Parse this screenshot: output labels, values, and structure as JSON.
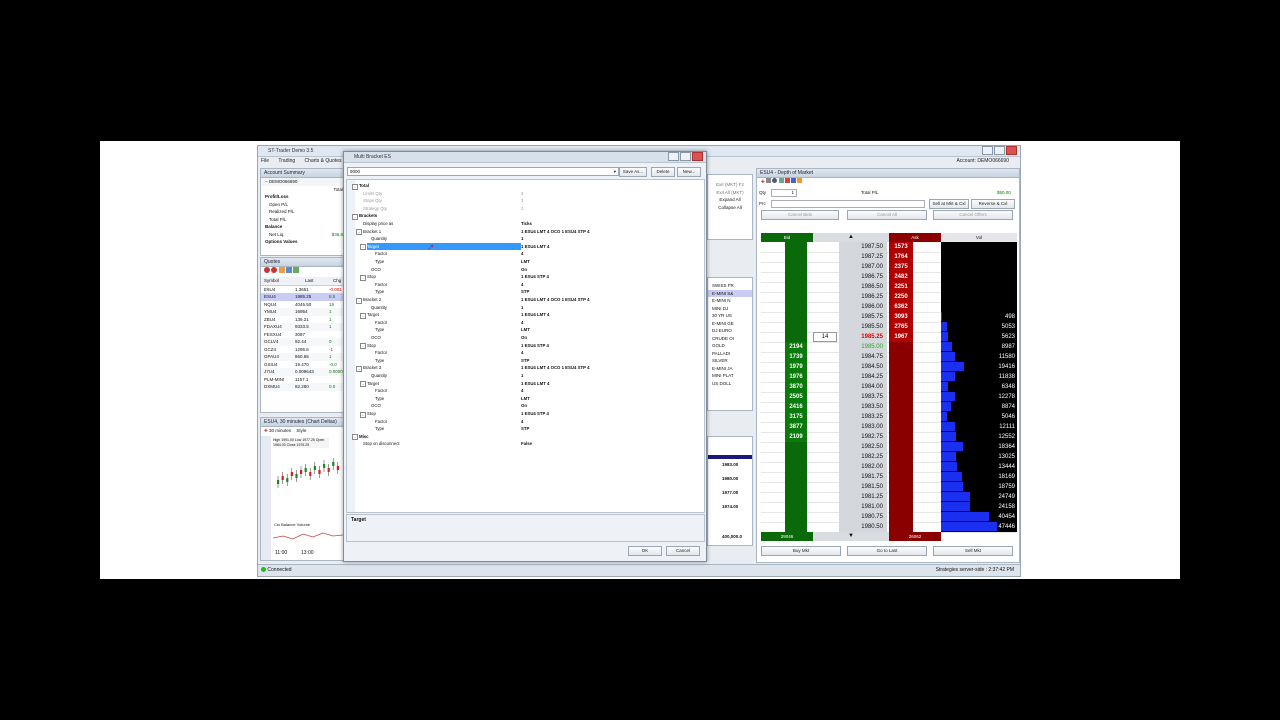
{
  "app": {
    "title": "ST-Trader Demo 3.5",
    "menu": [
      "File",
      "Trading",
      "Charts & Quotes"
    ],
    "account_label": "Account: DEMO066690",
    "status": "Connected",
    "strategies_status": "Strategies server-side : 2:37:42 PM"
  },
  "account_summary": {
    "header": "Account Summary",
    "account": "DEMO066690",
    "total_label": "Total",
    "rows": [
      "Profit/Loss",
      "Open P/L",
      "Realized P/L",
      "Total P/L",
      "Balance",
      "Net Liq.",
      "Options Values"
    ],
    "netliq_value": "$36,8"
  },
  "quotes": {
    "header": "Quotes",
    "columns": [
      "Symbol",
      "Last",
      "Chg"
    ],
    "rows": [
      {
        "symbol": "E6U4",
        "last": "1.3651",
        "chg": "-0.001"
      },
      {
        "symbol": "ESU4",
        "last": "1985.25",
        "chg": "8.5"
      },
      {
        "symbol": "NQU4",
        "last": "4045.50",
        "chg": "19"
      },
      {
        "symbol": "YMU4",
        "last": "16954",
        "chg": "1"
      },
      {
        "symbol": "ZBU4",
        "last": "139.21",
        "chg": "1"
      },
      {
        "symbol": "FDAXU4",
        "last": "9333.5",
        "chg": "1"
      },
      {
        "symbol": "FESXU4",
        "last": "3087",
        "chg": ""
      },
      {
        "symbol": "GCLV4",
        "last": "92.44",
        "chg": "0"
      },
      {
        "symbol": "GCZ4",
        "last": "1295.6",
        "chg": "-1"
      },
      {
        "symbol": "GPAU4",
        "last": "860.65",
        "chg": "1"
      },
      {
        "symbol": "GSIU4",
        "last": "19.470",
        "chg": "-0.0"
      },
      {
        "symbol": "J7U4",
        "last": "0.009643",
        "chg": "0.00000"
      },
      {
        "symbol": "PLM-MINI",
        "last": "1157.1",
        "chg": ""
      },
      {
        "symbol": "DXMU4",
        "last": "82.280",
        "chg": "0.0"
      }
    ]
  },
  "chart": {
    "header": "ESU4, 30 minutes (Chart Deltas)",
    "interval": "30 minutes",
    "style_label": "Style",
    "legend": "High 1991.00  Low 1977.25  Open 1984.00  Close 1976.25",
    "indicator": "Ctx Balance Volume",
    "times": [
      "11:00",
      "13:00"
    ]
  },
  "mid_panel": {
    "items": [
      "Exit (MKT) F2",
      "Exit All (MKT)",
      "Expand All",
      "Collapse All"
    ],
    "desc_rows": [
      "SWISS FR",
      "E-MINI S&",
      "E-MINI N",
      "MINI DJ",
      "30 YR US",
      "E-MINI GE",
      "DJ EURO",
      "CRUDE OI",
      "GOLD",
      "PALLADI",
      "SILVER",
      "E-MINI JA",
      "MINI PLAT",
      "US DOLL"
    ],
    "prices": [
      "1983.00",
      "1980.00",
      "1977.00",
      "1974.00",
      "400,000.0"
    ]
  },
  "dialog": {
    "title": "Multi Bracket ES",
    "preset": "9000",
    "save_as": "Save As...",
    "delete": "Delete",
    "new": "New...",
    "rows": [
      {
        "name": "Total",
        "val": "",
        "indent": 1,
        "cat": true,
        "exp": "-"
      },
      {
        "name": "Limits Qty",
        "val": "3",
        "indent": 2,
        "grey": true
      },
      {
        "name": "Stops Qty",
        "val": "3",
        "indent": 2,
        "grey": true
      },
      {
        "name": "Strategy Qty",
        "val": "3",
        "indent": 2,
        "grey": true
      },
      {
        "name": "Brackets",
        "val": "",
        "indent": 1,
        "cat": true,
        "exp": "-"
      },
      {
        "name": "Display price as",
        "val": "Ticks",
        "indent": 2
      },
      {
        "name": "Bracket 1",
        "val": "1 ESU4 LMT 4 OCO 1 ESU4 STP 4",
        "indent": 2,
        "exp": "-"
      },
      {
        "name": "Quantity",
        "val": "1",
        "indent": 4
      },
      {
        "name": "Target",
        "val": "1 ESU4 LMT 4",
        "indent": 3,
        "exp": "-",
        "selected": true
      },
      {
        "name": "Factor",
        "val": "4",
        "indent": 5
      },
      {
        "name": "Type",
        "val": "LMT",
        "indent": 5
      },
      {
        "name": "OCO",
        "val": "On",
        "indent": 4
      },
      {
        "name": "Stop",
        "val": "1 ESU4 STP 4",
        "indent": 3,
        "exp": "-"
      },
      {
        "name": "Factor",
        "val": "4",
        "indent": 5
      },
      {
        "name": "Type",
        "val": "STP",
        "indent": 5
      },
      {
        "name": "Bracket 2",
        "val": "1 ESU4 LMT 4 OCO 1 ESU4 STP 4",
        "indent": 2,
        "exp": "-"
      },
      {
        "name": "Quantity",
        "val": "1",
        "indent": 4
      },
      {
        "name": "Target",
        "val": "1 ESU4 LMT 4",
        "indent": 3,
        "exp": "-"
      },
      {
        "name": "Factor",
        "val": "4",
        "indent": 5
      },
      {
        "name": "Type",
        "val": "LMT",
        "indent": 5
      },
      {
        "name": "OCO",
        "val": "On",
        "indent": 4
      },
      {
        "name": "Stop",
        "val": "1 ESU4 STP 4",
        "indent": 3,
        "exp": "-"
      },
      {
        "name": "Factor",
        "val": "4",
        "indent": 5
      },
      {
        "name": "Type",
        "val": "STP",
        "indent": 5
      },
      {
        "name": "Bracket 3",
        "val": "1 ESU4 LMT 4 OCO 1 ESU4 STP 4",
        "indent": 2,
        "exp": "-"
      },
      {
        "name": "Quantity",
        "val": "1",
        "indent": 4
      },
      {
        "name": "Target",
        "val": "1 ESU4 LMT 4",
        "indent": 3,
        "exp": "-"
      },
      {
        "name": "Factor",
        "val": "4",
        "indent": 5
      },
      {
        "name": "Type",
        "val": "LMT",
        "indent": 5
      },
      {
        "name": "OCO",
        "val": "On",
        "indent": 4
      },
      {
        "name": "Stop",
        "val": "1 ESU4 STP 4",
        "indent": 3,
        "exp": "-"
      },
      {
        "name": "Factor",
        "val": "4",
        "indent": 5
      },
      {
        "name": "Type",
        "val": "STP",
        "indent": 5
      },
      {
        "name": "Misc",
        "val": "",
        "indent": 1,
        "cat": true,
        "exp": "-"
      },
      {
        "name": "Stop on disconnect",
        "val": "False",
        "indent": 2
      }
    ],
    "description_title": "Target",
    "ok": "OK",
    "cancel": "Cancel"
  },
  "dom": {
    "header": "ESU4 - Depth of Market",
    "qty_label": "Qty",
    "qty_value": "1",
    "total_pl_label": "Total P/L",
    "total_pl_value": "$50.00",
    "price_label": "Prc",
    "buttons_top": [
      "Sell at Mkt & Cxl",
      "Reverse & Cxl",
      "Cancel Bids",
      "Cancel All",
      "Cancel Offers"
    ],
    "col_bid": "Bid",
    "col_ask": "Ask",
    "col_vol": "Vol",
    "rows": [
      {
        "price": "1987.50",
        "ask": "1573",
        "vol": ""
      },
      {
        "price": "1987.25",
        "ask": "1764",
        "vol": ""
      },
      {
        "price": "1987.00",
        "ask": "2375",
        "vol": ""
      },
      {
        "price": "1986.75",
        "ask": "2482",
        "vol": ""
      },
      {
        "price": "1986.50",
        "ask": "2251",
        "vol": ""
      },
      {
        "price": "1986.25",
        "ask": "2250",
        "vol": ""
      },
      {
        "price": "1986.00",
        "ask": "6362",
        "vol": ""
      },
      {
        "price": "1985.75",
        "ask": "3093",
        "vol": "498"
      },
      {
        "price": "1985.50",
        "ask": "2765",
        "vol": "5053"
      },
      {
        "price": "1985.25",
        "ask": "1967",
        "vol": "5623",
        "last": true,
        "pos": "14"
      },
      {
        "price": "1985.00",
        "bid": "2194",
        "vol": "8987",
        "bidlast": true
      },
      {
        "price": "1984.75",
        "bid": "1739",
        "vol": "11580"
      },
      {
        "price": "1984.50",
        "bid": "1979",
        "vol": "19416"
      },
      {
        "price": "1984.25",
        "bid": "1976",
        "vol": "11838"
      },
      {
        "price": "1984.00",
        "bid": "3870",
        "vol": "6348"
      },
      {
        "price": "1983.75",
        "bid": "2505",
        "vol": "12278"
      },
      {
        "price": "1983.50",
        "bid": "2416",
        "vol": "8874"
      },
      {
        "price": "1983.25",
        "bid": "3175",
        "vol": "5046"
      },
      {
        "price": "1983.00",
        "bid": "3877",
        "vol": "12111"
      },
      {
        "price": "1982.75",
        "bid": "2109",
        "vol": "12552"
      },
      {
        "price": "1982.50",
        "vol": "18364"
      },
      {
        "price": "1982.25",
        "vol": "13025"
      },
      {
        "price": "1982.00",
        "vol": "13444"
      },
      {
        "price": "1981.75",
        "vol": "18169"
      },
      {
        "price": "1981.50",
        "vol": "18759"
      },
      {
        "price": "1981.25",
        "vol": "24749"
      },
      {
        "price": "1981.00",
        "vol": "24158"
      },
      {
        "price": "1980.75",
        "vol": "40454"
      },
      {
        "price": "1980.50",
        "vol": "47446"
      }
    ],
    "bid_total": "29046",
    "ask_total": "26062",
    "buy_mkt": "Buy Mkt",
    "go_to_last": "Go to Last",
    "sell_mkt": "Sell Mkt",
    "colors": {
      "bid": "#0a7a0a",
      "ask": "#b00000",
      "vol": "#1a2ff0"
    }
  }
}
